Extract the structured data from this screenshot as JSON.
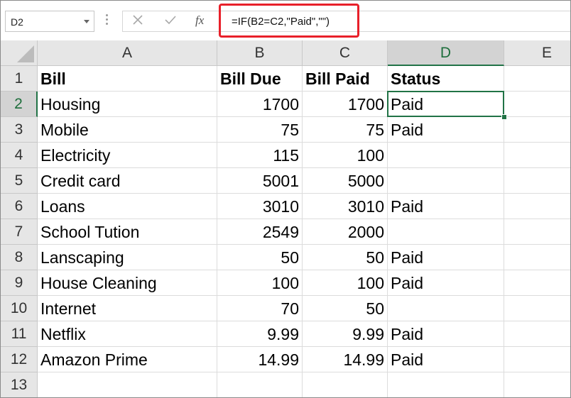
{
  "name_box": "D2",
  "formula": "=IF(B2=C2,\"Paid\",\"\")",
  "icons": {
    "cancel": "cancel-x-icon",
    "enter": "enter-check-icon",
    "function": "insert-function-icon"
  },
  "fx_label": "fx",
  "accent_color": "#217346",
  "highlight_color": "#e8202a",
  "columns": [
    "A",
    "B",
    "C",
    "D",
    "E"
  ],
  "rows": [
    "1",
    "2",
    "3",
    "4",
    "5",
    "6",
    "7",
    "8",
    "9",
    "10",
    "11",
    "12",
    "13"
  ],
  "selected_cell": "D2",
  "sheet": [
    [
      "Bill",
      "Bill Due",
      "Bill Paid",
      "Status",
      ""
    ],
    [
      "Housing",
      "1700",
      "1700",
      "Paid",
      ""
    ],
    [
      "Mobile",
      "75",
      "75",
      "Paid",
      ""
    ],
    [
      "Electricity",
      "115",
      "100",
      "",
      ""
    ],
    [
      "Credit card",
      "5001",
      "5000",
      "",
      ""
    ],
    [
      "Loans",
      "3010",
      "3010",
      "Paid",
      ""
    ],
    [
      "School Tution",
      "2549",
      "2000",
      "",
      ""
    ],
    [
      "Lanscaping",
      "50",
      "50",
      "Paid",
      ""
    ],
    [
      "House Cleaning",
      "100",
      "100",
      "Paid",
      ""
    ],
    [
      "Internet",
      "70",
      "50",
      "",
      ""
    ],
    [
      "Netflix",
      "9.99",
      "9.99",
      "Paid",
      ""
    ],
    [
      "Amazon Prime",
      "14.99",
      "14.99",
      "Paid",
      ""
    ],
    [
      "",
      "",
      "",
      "",
      ""
    ]
  ]
}
